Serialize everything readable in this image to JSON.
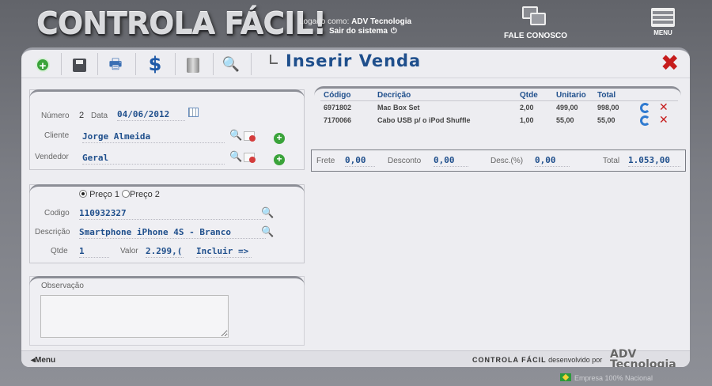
{
  "header": {
    "logo_text": "CONTROLA FÁCIL!",
    "logged_label": "Logado como:",
    "logged_user": "ADV Tecnologia",
    "logout_label": "Sair do sistema",
    "contact_label": "FALE CONOSCO",
    "menu_label": "MENU"
  },
  "page": {
    "title": "Inserir Venda",
    "toolbar_icons": [
      "add-icon",
      "save-icon",
      "print-icon",
      "money-icon",
      "trash-icon",
      "search-icon"
    ]
  },
  "sale": {
    "numero_label": "Número",
    "numero": "2",
    "data_label": "Data",
    "data": "04/06/2012",
    "cliente_label": "Cliente",
    "cliente": "Jorge Almeida",
    "vendedor_label": "Vendedor",
    "vendedor": "Geral"
  },
  "product": {
    "preco1_label": "Preço 1",
    "preco2_label": "Preço 2",
    "preco_selected": "Preço 1",
    "codigo_label": "Codigo",
    "codigo": "110932327",
    "descricao_label": "Descrição",
    "descricao": "Smartphone iPhone 4S - Branco",
    "qtde_label": "Qtde",
    "qtde": "1",
    "valor_label": "Valor",
    "valor": "2.299,(",
    "incluir_label": "Incluir =>"
  },
  "observacao": {
    "label": "Observação",
    "value": ""
  },
  "items": {
    "headers": [
      "Código",
      "Decrição",
      "Qtde",
      "Unitario",
      "Total"
    ],
    "rows": [
      [
        "6971802",
        "Mac Box Set",
        "2,00",
        "499,00",
        "998,00"
      ],
      [
        "7170066",
        "Cabo USB p/ o iPod Shuffle",
        "1,00",
        "55,00",
        "55,00"
      ]
    ]
  },
  "totals": {
    "frete_label": "Frete",
    "frete": "0,00",
    "desconto_label": "Desconto",
    "desconto": "0,00",
    "desc_pct_label": "Desc.(%)",
    "desc_pct": "0,00",
    "total_label": "Total",
    "total": "1.053,00"
  },
  "footer": {
    "back_label": "Menu",
    "brand": "CONTROLA FÁCIL",
    "developed_by": "desenvolvido por",
    "adv_logo": "ADV Tecnologia",
    "nacional": "Empresa 100% Nacional"
  }
}
